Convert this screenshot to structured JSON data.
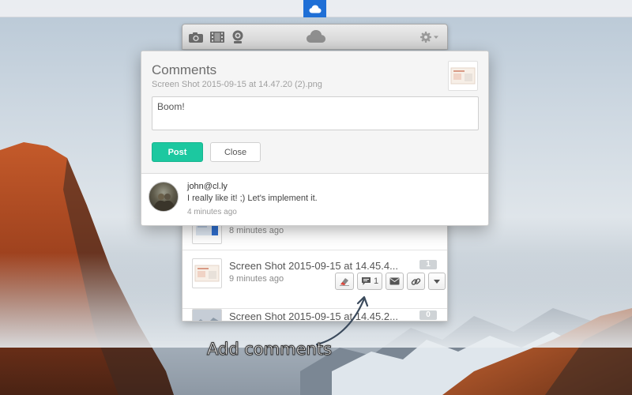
{
  "toolbar": {
    "icons": [
      "camera-icon",
      "film-icon",
      "webcam-icon",
      "cloud-icon",
      "gear-icon"
    ]
  },
  "comments_popup": {
    "title": "Comments",
    "filename": "Screen Shot 2015-09-15 at 14.47.20 (2).png",
    "input_value": "Boom!",
    "post_label": "Post",
    "close_label": "Close",
    "comment": {
      "author": "john@cl.ly",
      "text": "I really like it! ;) Let's implement it.",
      "time": "4 minutes ago"
    }
  },
  "shot_list": {
    "rows": [
      {
        "title": "",
        "time": "8 minutes ago",
        "count": ""
      },
      {
        "title": "Screen Shot 2015-09-15 at 14.45.4...",
        "time": "9 minutes ago",
        "count": "1"
      },
      {
        "title": "Screen Shot 2015-09-15 at 14.45.2...",
        "time": "",
        "count": "0"
      }
    ],
    "actions": {
      "comment_count": "1"
    }
  },
  "annotation": {
    "text": "Add comments"
  },
  "colors": {
    "accent": "#1cc8a0",
    "menubar_highlight": "#1f6fd6"
  }
}
